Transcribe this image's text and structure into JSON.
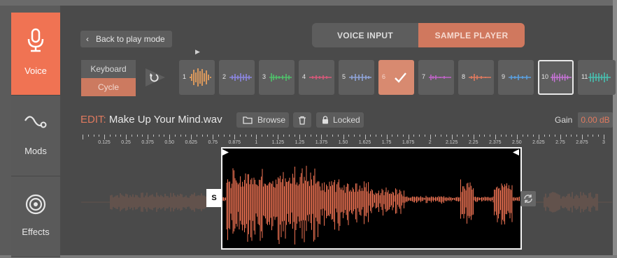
{
  "sidebar": {
    "items": [
      {
        "label": "Voice",
        "icon": "microphone-icon",
        "active": true
      },
      {
        "label": "Mods",
        "icon": "mods-curve-icon",
        "active": false
      },
      {
        "label": "Effects",
        "icon": "target-icon",
        "active": false
      }
    ]
  },
  "header": {
    "back_label": "Back to play mode",
    "mode_voice": "VOICE INPUT",
    "mode_sample": "SAMPLE PLAYER"
  },
  "trigger": {
    "keyboard_label": "Keyboard",
    "cycle_label": "Cycle"
  },
  "slots": [
    {
      "num": "1",
      "color": "#d9985c"
    },
    {
      "num": "2",
      "color": "#8c86e0"
    },
    {
      "num": "3",
      "color": "#4fc06a"
    },
    {
      "num": "4",
      "color": "#d8587a"
    },
    {
      "num": "5",
      "color": "#8fa4d8"
    },
    {
      "num": "6",
      "color": "#d88a70"
    },
    {
      "num": "7",
      "color": "#c064c8"
    },
    {
      "num": "8",
      "color": "#e07a5f"
    },
    {
      "num": "9",
      "color": "#5aa0e0"
    },
    {
      "num": "10",
      "color": "#c874d8"
    },
    {
      "num": "11",
      "color": "#48c0b0"
    }
  ],
  "edit": {
    "prefix": "EDIT:",
    "filename": "Make Up Your Mind.wav",
    "browse_label": "Browse",
    "locked_label": "Locked",
    "gain_label": "Gain",
    "gain_value": "0.00 dB"
  },
  "ruler": {
    "labels": [
      "0.125",
      "0.25",
      "0.375",
      "0.50",
      "0.625",
      "0.75",
      "0.875",
      "1",
      "1.125",
      "1.25",
      "1.375",
      "1.50",
      "1.625",
      "1.75",
      "1.875",
      "2",
      "2.125",
      "2.25",
      "2.375",
      "2.50",
      "2.625",
      "2.75",
      "2.875",
      "3"
    ]
  },
  "waveform": {
    "start_tag": "S",
    "accent": "#f07353"
  }
}
